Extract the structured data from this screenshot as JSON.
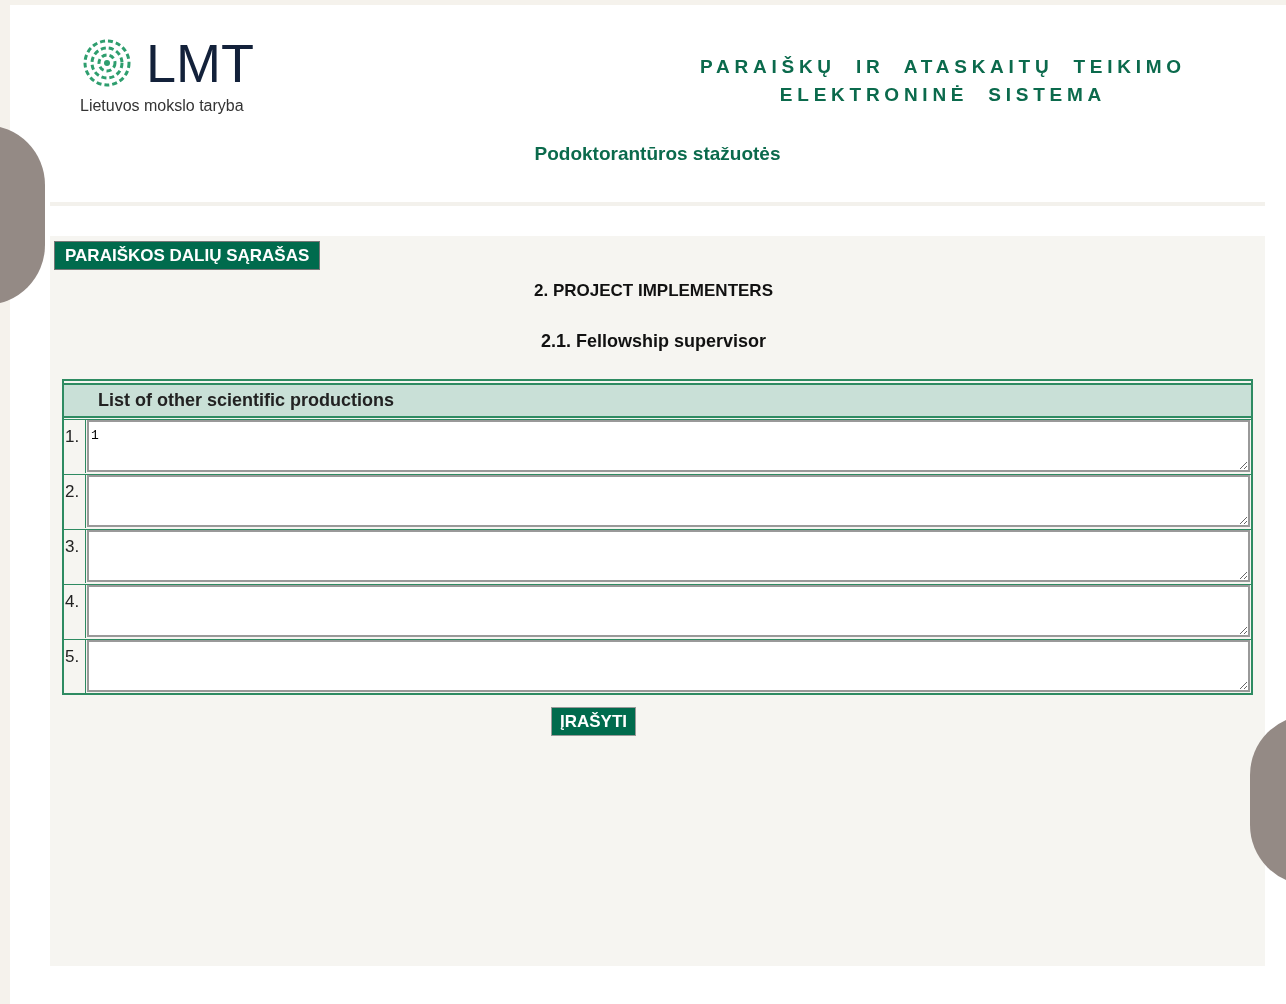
{
  "logo": {
    "name": "LMT",
    "tagline": "Lietuvos mokslo taryba"
  },
  "system_title": [
    "PARAIŠKŲ  IR  ATASKAITŲ  TEIKIMO",
    "ELEKTRONINĖ  SISTEMA"
  ],
  "program_title": "Podoktorantūros stažuotės",
  "nav_button": "PARAIŠKOS DALIŲ SĄRAŠAS",
  "section_title": "2. PROJECT IMPLEMENTERS",
  "subsection_title": "2.1. Fellowship supervisor",
  "table": {
    "header": "List of other scientific productions",
    "rows": [
      {
        "number": "1.",
        "value": "1"
      },
      {
        "number": "2."
      },
      {
        "number": "3."
      },
      {
        "number": "4."
      },
      {
        "number": "5."
      }
    ]
  },
  "save_button": "ĮRAŠYTI"
}
